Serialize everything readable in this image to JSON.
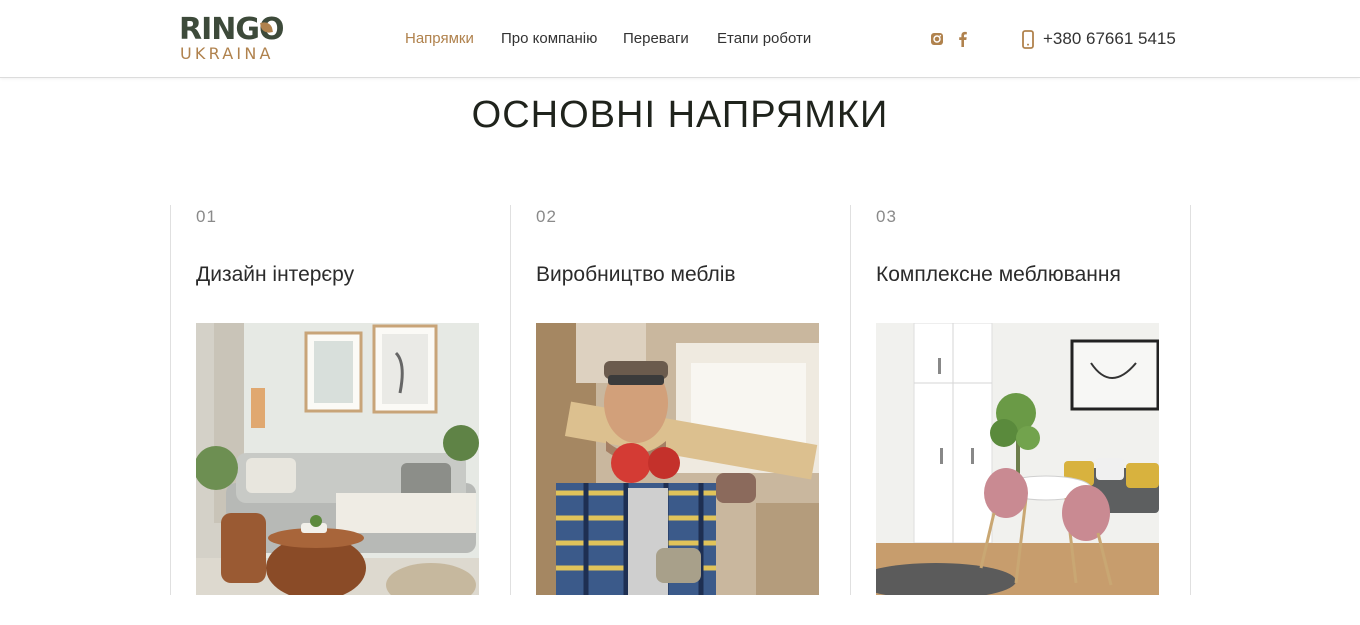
{
  "header": {
    "logo": {
      "top": "RINGO",
      "bottom": "UKRAINA"
    },
    "nav": [
      {
        "label": "Напрямки",
        "active": true
      },
      {
        "label": "Про компанію",
        "active": false
      },
      {
        "label": "Переваги",
        "active": false
      },
      {
        "label": "Етапи роботи",
        "active": false
      }
    ],
    "social": [
      {
        "icon": "instagram-icon"
      },
      {
        "icon": "facebook-icon"
      }
    ],
    "phone": {
      "icon": "mobile-phone-icon",
      "number": "+380 67661 5415"
    }
  },
  "main": {
    "title": "ОСНОВНІ НАПРЯМКИ",
    "cards": [
      {
        "num": "01",
        "title": "Дизайн інтерєру",
        "image": "living-room-interior-photo"
      },
      {
        "num": "02",
        "title": "Виробництво меблів",
        "image": "carpenter-with-wood-photo"
      },
      {
        "num": "03",
        "title": "Комплексне меблювання",
        "image": "furnished-dining-corner-photo"
      }
    ]
  },
  "colors": {
    "accent": "#b0824d",
    "logo_dark": "#3d4a3a",
    "text": "#333333",
    "divider": "#e0e0e0"
  }
}
